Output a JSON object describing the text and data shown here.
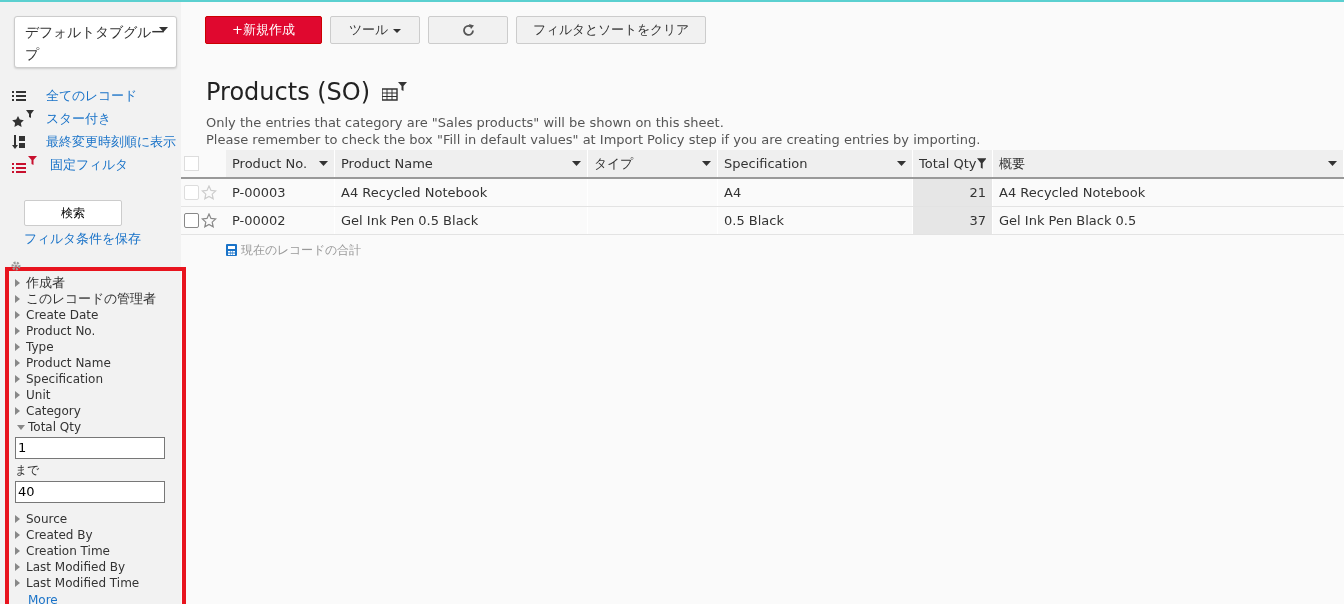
{
  "sidebar": {
    "tab_group": "デフォルトタブグループ",
    "views": [
      {
        "label": "全てのレコード",
        "kind": "list"
      },
      {
        "label": "スター付き",
        "kind": "star"
      },
      {
        "label": "最終変更時刻順に表示",
        "kind": "sort"
      },
      {
        "label": "固定フィルタ",
        "kind": "fixed"
      }
    ],
    "search_button": "検索",
    "save_filter": "フィルタ条件を保存",
    "filters": [
      {
        "label": "作成者",
        "expanded": false
      },
      {
        "label": "このレコードの管理者",
        "expanded": false
      },
      {
        "label": "Create Date",
        "expanded": false
      },
      {
        "label": "Product No.",
        "expanded": false
      },
      {
        "label": "Type",
        "expanded": false
      },
      {
        "label": "Product Name",
        "expanded": false
      },
      {
        "label": "Specification",
        "expanded": false
      },
      {
        "label": "Unit",
        "expanded": false
      },
      {
        "label": "Category",
        "expanded": false
      },
      {
        "label": "Total Qty",
        "expanded": true,
        "from": "1",
        "to_label": "まで",
        "to": "40"
      },
      {
        "label": "Source",
        "expanded": false
      },
      {
        "label": "Created By",
        "expanded": false
      },
      {
        "label": "Creation Time",
        "expanded": false
      },
      {
        "label": "Last Modified By",
        "expanded": false
      },
      {
        "label": "Last Modified Time",
        "expanded": false
      }
    ],
    "more": "More"
  },
  "toolbar": {
    "new_button": "+新規作成",
    "tools_button": "ツール",
    "clear_button": "フィルタとソートをクリア"
  },
  "title": "Products (SO)",
  "notes": [
    "Only the entries that category are \"Sales products\" will be shown on this sheet.",
    "Please remember to check the box \"Fill in default values\" at Import Policy step if you are creating entries by importing."
  ],
  "table": {
    "header_checked": false,
    "columns": [
      {
        "label": "Product No.",
        "filtered": false,
        "kind": "text"
      },
      {
        "label": "Product Name",
        "filtered": false,
        "kind": "text"
      },
      {
        "label": "タイプ",
        "filtered": false,
        "kind": "text"
      },
      {
        "label": "Specification",
        "filtered": false,
        "kind": "text"
      },
      {
        "label": "Total Qty",
        "filtered": true,
        "kind": "number"
      },
      {
        "label": "概要",
        "filtered": false,
        "kind": "text"
      }
    ],
    "rows": [
      {
        "checked": false,
        "starred": false,
        "cells": [
          "P-00003",
          "A4 Recycled Notebook",
          "",
          "A4",
          "21",
          "A4 Recycled Notebook"
        ]
      },
      {
        "checked": false,
        "starred": false,
        "cells": [
          "P-00002",
          "Gel Ink Pen 0.5 Black",
          "",
          "0.5 Black",
          "37",
          "Gel Ink Pen Black 0.5"
        ]
      }
    ],
    "footer": "現在のレコードの合計"
  }
}
